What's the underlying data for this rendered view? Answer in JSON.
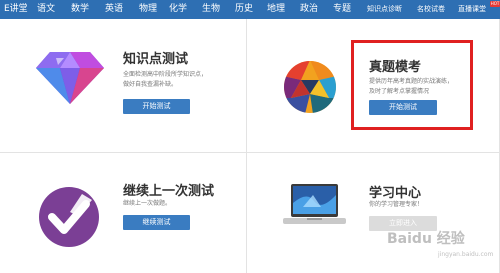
{
  "nav": {
    "items": [
      "E讲堂",
      "语文",
      "数学",
      "英语",
      "物理",
      "化学",
      "生物",
      "历史",
      "地理",
      "政治",
      "专题",
      "知识点诊断",
      "名校试卷",
      "直播课堂"
    ],
    "hot_badge": "HOT"
  },
  "cards": {
    "knowledge": {
      "title": "知识点测试",
      "desc": [
        "全面检测高中阶段所学知识点，",
        "做好自我查漏补缺。"
      ],
      "button": "开始测试"
    },
    "mock": {
      "title": "真题模考",
      "desc": [
        "提供历年高考真题的实战演练，",
        "及时了解考点掌握情况"
      ],
      "button": "开始测试"
    },
    "continue": {
      "title": "继续上一次测试",
      "desc": "继续上一次做题。",
      "button": "继续测试"
    },
    "center": {
      "title": "学习中心",
      "desc": "你的学习管理专家！",
      "button": "立即进入"
    }
  },
  "watermark": {
    "text": "Baidu 经验",
    "sub": "jingyan.baidu.com"
  },
  "colors": {
    "nav_bg": "#2e6fb3",
    "button": "#3a7cc1",
    "highlight": "#e02020"
  }
}
